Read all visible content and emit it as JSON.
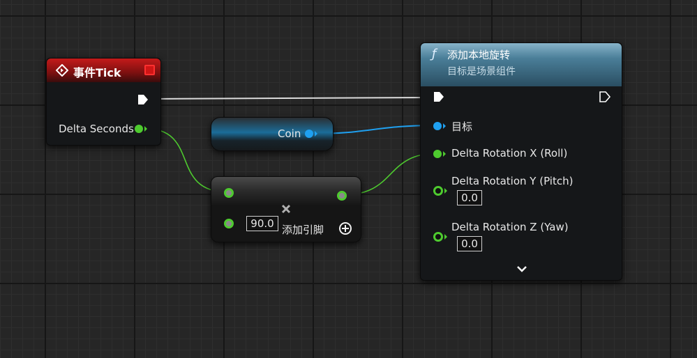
{
  "tick_node": {
    "title": "事件Tick",
    "output_label": "Delta Seconds"
  },
  "coin_node": {
    "label": "Coin"
  },
  "multiply_node": {
    "value": "90.0",
    "add_pin_label": "添加引脚"
  },
  "function_node": {
    "title": "添加本地旋转",
    "subtitle": "目标是场景组件",
    "target_label": "目标",
    "pin_roll": "Delta Rotation X (Roll)",
    "pin_pitch": "Delta Rotation Y (Pitch)",
    "pin_pitch_value": "0.0",
    "pin_yaw": "Delta Rotation Z (Yaw)",
    "pin_yaw_value": "0.0"
  },
  "colors": {
    "event_header": "#c41a1a",
    "function_header": "#4a7e98",
    "float_pin": "#4ecb2f",
    "object_pin": "#1fa0f0",
    "exec_wire": "#e6e6e6"
  }
}
